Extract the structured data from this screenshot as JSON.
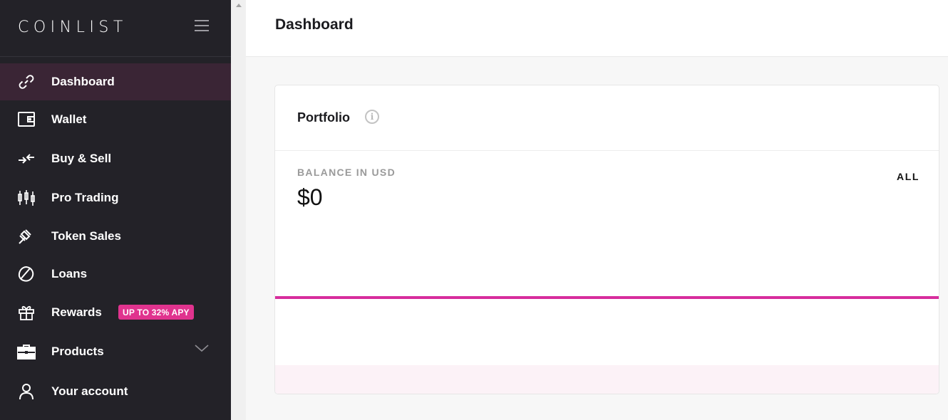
{
  "brand": {
    "logo": "COINLIST"
  },
  "sidebar": {
    "items": [
      {
        "label": "Dashboard",
        "icon": "link-icon",
        "active": true
      },
      {
        "label": "Wallet",
        "icon": "wallet-icon"
      },
      {
        "label": "Buy & Sell",
        "icon": "swap-arrows-icon"
      },
      {
        "label": "Pro Trading",
        "icon": "candlestick-icon"
      },
      {
        "label": "Token Sales",
        "icon": "gavel-icon"
      },
      {
        "label": "Loans",
        "icon": "seed-icon"
      },
      {
        "label": "Rewards",
        "icon": "gift-icon",
        "badge": "UP TO 32% APY"
      },
      {
        "label": "Products",
        "icon": "briefcase-icon"
      },
      {
        "label": "Your account",
        "icon": "user-icon"
      }
    ]
  },
  "header": {
    "title": "Dashboard"
  },
  "portfolio": {
    "title": "Portfolio",
    "balance_label": "BALANCE IN USD",
    "balance_value": "$0",
    "range": "ALL"
  },
  "colors": {
    "sidebar_bg": "#232228",
    "active_bg": "#3a2535",
    "accent": "#d72d9d",
    "badge": "#e0338e"
  }
}
